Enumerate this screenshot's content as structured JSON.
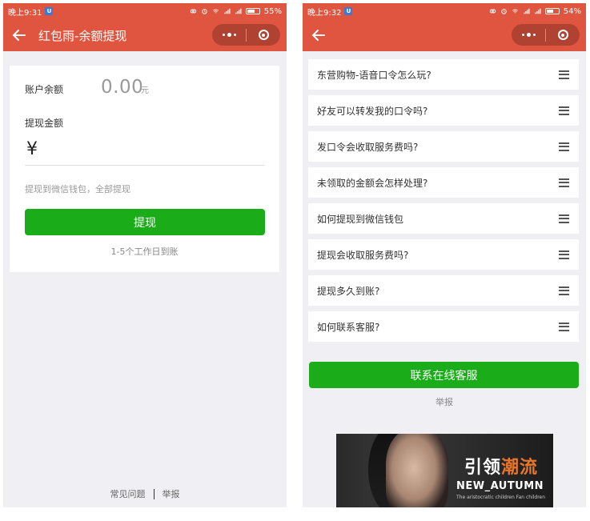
{
  "left": {
    "status": {
      "time": "晚上9:31",
      "battery": "55%",
      "battery_level": 0.55
    },
    "nav": {
      "title": "红包雨-余额提现"
    },
    "balance": {
      "label": "账户余额",
      "value": "0.00",
      "unit": "元"
    },
    "withdraw": {
      "label": "提现金额",
      "currency": "¥",
      "hint": "提现到微信钱包，全部提现",
      "button": "提现",
      "arrival_note": "1-5个工作日到账"
    },
    "footer": {
      "faq": "常见问题",
      "report": "举报"
    }
  },
  "right": {
    "status": {
      "time": "晚上9:32",
      "battery": "54%",
      "battery_level": 0.54
    },
    "faq": [
      "东营购物-语音口令怎么玩?",
      "好友可以转发我的口令吗?",
      "发口令会收取服务费吗?",
      "未领取的金额会怎样处理?",
      "如何提现到微信钱包",
      "提现会收取服务费吗?",
      "提现多久到账?",
      "如何联系客服?"
    ],
    "service_button": "联系在线客服",
    "report": "举报",
    "ad": {
      "cn_a": "引领",
      "cn_b": "潮流",
      "en": "NEW_AUTUMN",
      "sub": "The aristocratic children Fan children"
    }
  },
  "colors": {
    "theme": "#e0553f",
    "primary_button": "#1aad19"
  }
}
